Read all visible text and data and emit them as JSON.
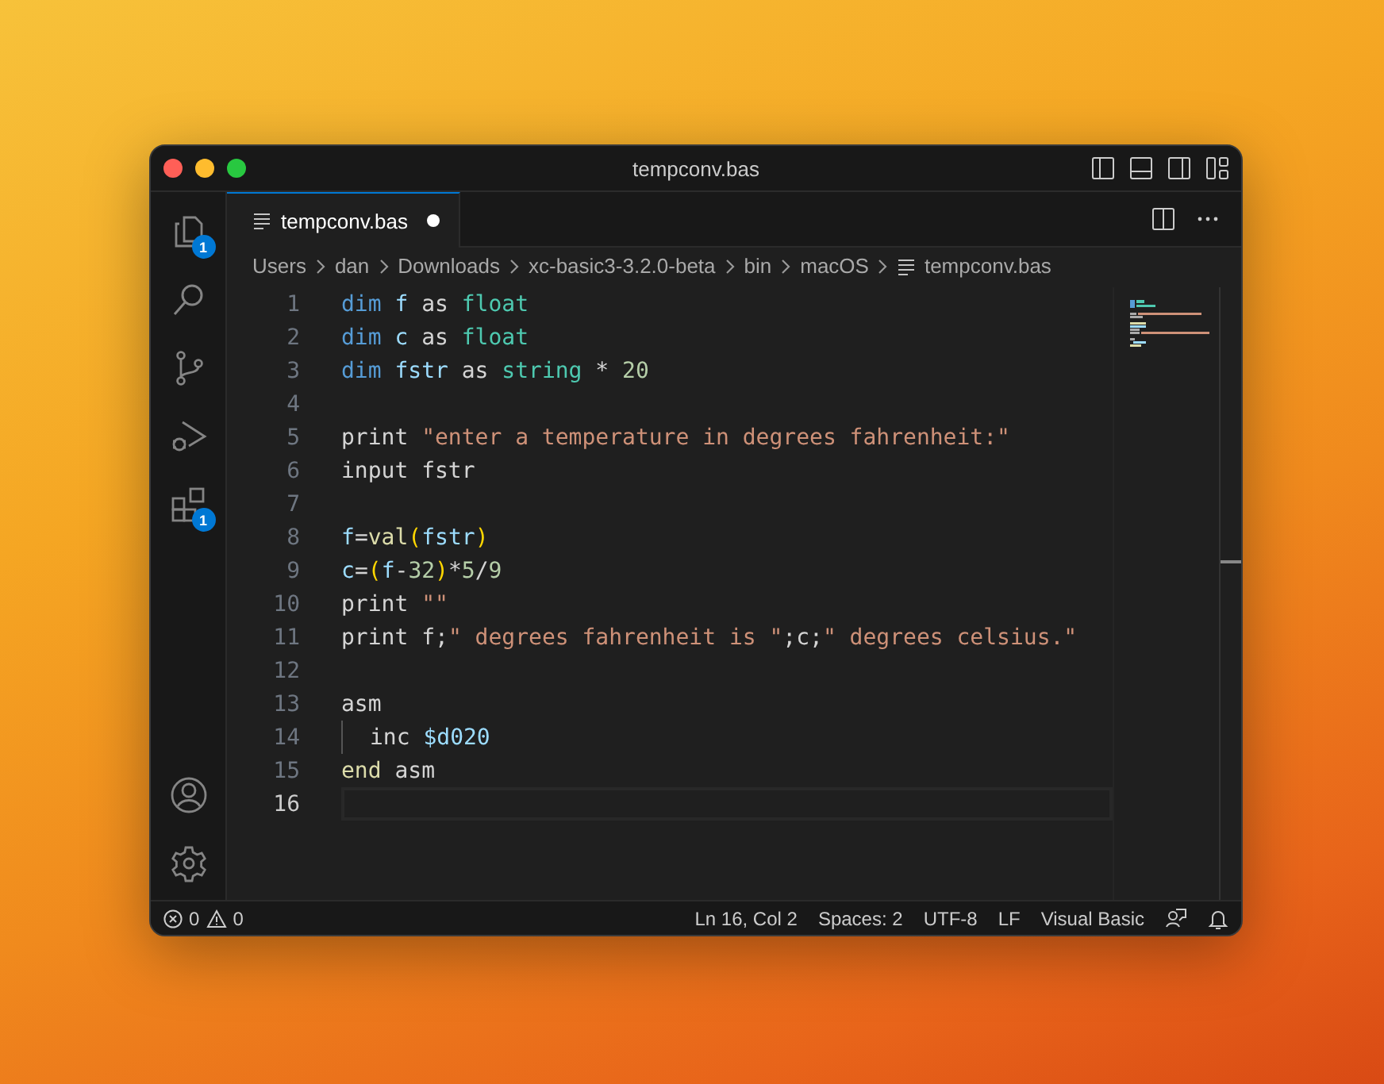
{
  "window": {
    "title": "tempconv.bas"
  },
  "activity_bar": [
    {
      "kind": "files",
      "badge": "1"
    },
    {
      "kind": "search"
    },
    {
      "kind": "source-control"
    },
    {
      "kind": "run-debug"
    },
    {
      "kind": "extensions",
      "badge": "1"
    }
  ],
  "activity_bar_bottom": [
    {
      "kind": "account"
    },
    {
      "kind": "settings"
    }
  ],
  "tabs": [
    {
      "label": "tempconv.bas",
      "modified": true,
      "selected": true
    }
  ],
  "breadcrumbs": [
    "Users",
    "dan",
    "Downloads",
    "xc-basic3-3.2.0-beta",
    "bin",
    "macOS",
    "tempconv.bas"
  ],
  "editor": {
    "lines": [
      {
        "number": "1",
        "current": false,
        "tokens": [
          {
            "kind": "keyword",
            "text": "dim "
          },
          {
            "kind": "variable",
            "text": "f"
          },
          {
            "kind": "plain",
            "text": " as "
          },
          {
            "kind": "type",
            "text": "float"
          }
        ]
      },
      {
        "number": "2",
        "current": false,
        "tokens": [
          {
            "kind": "keyword",
            "text": "dim "
          },
          {
            "kind": "variable",
            "text": "c"
          },
          {
            "kind": "plain",
            "text": " as "
          },
          {
            "kind": "type",
            "text": "float"
          }
        ]
      },
      {
        "number": "3",
        "current": false,
        "tokens": [
          {
            "kind": "keyword",
            "text": "dim "
          },
          {
            "kind": "variable",
            "text": "fstr"
          },
          {
            "kind": "plain",
            "text": " as "
          },
          {
            "kind": "type",
            "text": "string"
          },
          {
            "kind": "plain",
            "text": " * "
          },
          {
            "kind": "number",
            "text": "20"
          }
        ]
      },
      {
        "number": "4",
        "current": false
      },
      {
        "number": "5",
        "current": false,
        "tokens": [
          {
            "kind": "plain",
            "text": "print "
          },
          {
            "kind": "string",
            "text": "\"enter a temperature in degrees fahrenheit:\""
          }
        ]
      },
      {
        "number": "6",
        "current": false,
        "tokens": [
          {
            "kind": "plain",
            "text": "input fstr"
          }
        ]
      },
      {
        "number": "7",
        "current": false
      },
      {
        "number": "8",
        "current": false,
        "tokens": [
          {
            "kind": "variable",
            "text": "f"
          },
          {
            "kind": "plain",
            "text": "="
          },
          {
            "kind": "function",
            "text": "val"
          },
          {
            "kind": "paren",
            "text": "("
          },
          {
            "kind": "variable",
            "text": "fstr"
          },
          {
            "kind": "paren",
            "text": ")"
          }
        ]
      },
      {
        "number": "9",
        "current": false,
        "tokens": [
          {
            "kind": "variable",
            "text": "c"
          },
          {
            "kind": "plain",
            "text": "="
          },
          {
            "kind": "paren",
            "text": "("
          },
          {
            "kind": "variable",
            "text": "f"
          },
          {
            "kind": "plain",
            "text": "-"
          },
          {
            "kind": "number",
            "text": "32"
          },
          {
            "kind": "paren",
            "text": ")"
          },
          {
            "kind": "plain",
            "text": "*"
          },
          {
            "kind": "number",
            "text": "5"
          },
          {
            "kind": "plain",
            "text": "/"
          },
          {
            "kind": "number",
            "text": "9"
          }
        ]
      },
      {
        "number": "10",
        "current": false,
        "tokens": [
          {
            "kind": "plain",
            "text": "print "
          },
          {
            "kind": "string",
            "text": "\"\""
          }
        ]
      },
      {
        "number": "11",
        "current": false,
        "tokens": [
          {
            "kind": "plain",
            "text": "print f;"
          },
          {
            "kind": "string",
            "text": "\" degrees fahrenheit is \""
          },
          {
            "kind": "plain",
            "text": ";c;"
          },
          {
            "kind": "string",
            "text": "\" degrees celsius.\""
          }
        ]
      },
      {
        "number": "12",
        "current": false
      },
      {
        "number": "13",
        "current": false,
        "tokens": [
          {
            "kind": "plain",
            "text": "asm"
          }
        ]
      },
      {
        "number": "14",
        "current": false,
        "indent_guide": true,
        "tokens": [
          {
            "kind": "plain",
            "text": "inc "
          },
          {
            "kind": "variable",
            "text": "$d020"
          }
        ]
      },
      {
        "number": "15",
        "current": false,
        "tokens": [
          {
            "kind": "function",
            "text": "end"
          },
          {
            "kind": "plain",
            "text": " asm"
          }
        ]
      },
      {
        "number": "16",
        "current": true
      }
    ]
  },
  "status_bar": {
    "errors": "0",
    "warnings": "0",
    "items": [
      "Ln 16, Col 2",
      "Spaces: 2",
      "UTF-8",
      "LF",
      "Visual Basic"
    ]
  }
}
